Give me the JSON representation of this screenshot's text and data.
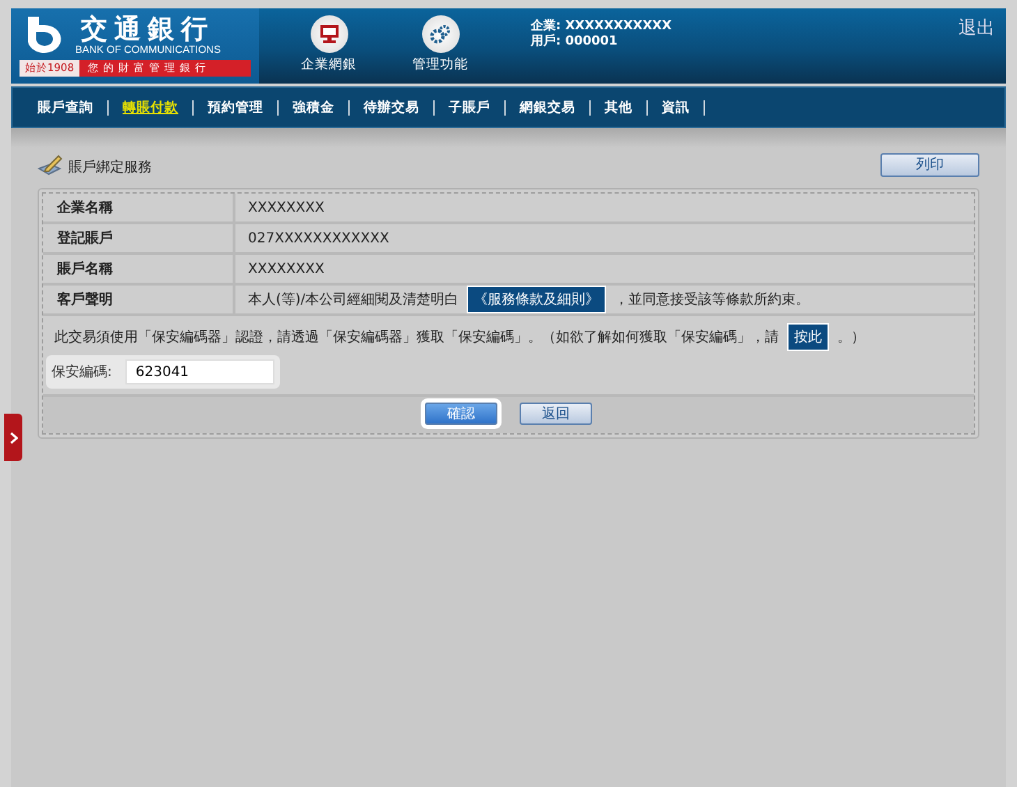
{
  "header": {
    "logo": {
      "name": "交通銀行",
      "english": "BANK OF COMMUNICATIONS",
      "since": "始於1908",
      "slogan": "您的財富管理銀行"
    },
    "shortcuts": [
      {
        "kind": "monitor",
        "label": "企業網銀"
      },
      {
        "kind": "gears",
        "label": "管理功能"
      }
    ],
    "company": "企業: XXXXXXXXXXX",
    "user": "用戶: 000001",
    "logout": "退出"
  },
  "nav": [
    {
      "label": "賬戶查詢",
      "selected": false
    },
    {
      "label": "轉賬付款",
      "selected": true
    },
    {
      "label": "預約管理",
      "selected": false
    },
    {
      "label": "強積金",
      "selected": false
    },
    {
      "label": "待辦交易",
      "selected": false
    },
    {
      "label": "子賬戶",
      "selected": false
    },
    {
      "label": "網銀交易",
      "selected": false
    },
    {
      "label": "其他",
      "selected": false
    },
    {
      "label": "資訊",
      "selected": false
    }
  ],
  "page_title": "賬戶綁定服務",
  "print_button": "列印",
  "details": [
    {
      "label": "企業名稱",
      "value": "XXXXXXXX"
    },
    {
      "label": "登記賬戶",
      "value": "027XXXXXXXXXXXX"
    },
    {
      "label": "賬戶名稱",
      "value": "XXXXXXXX"
    }
  ],
  "declaration": {
    "label": "客戶聲明",
    "before": "本人(等)/本公司經細閱及清楚明白",
    "link": "《服務條款及細則》",
    "after": "，並同意接受該等條款所約束。"
  },
  "notice": {
    "before": "此交易須使用「保安編碼器」認證，請透過「保安編碼器」獲取「保安編碼」。（如欲了解如何獲取「保安編碼」，請",
    "link": "按此",
    "after": "。）"
  },
  "code_field": {
    "label": "保安編碼:",
    "value": "623041"
  },
  "buttons": [
    {
      "label": "確認",
      "focused": true
    },
    {
      "label": "返回",
      "focused": false
    }
  ]
}
